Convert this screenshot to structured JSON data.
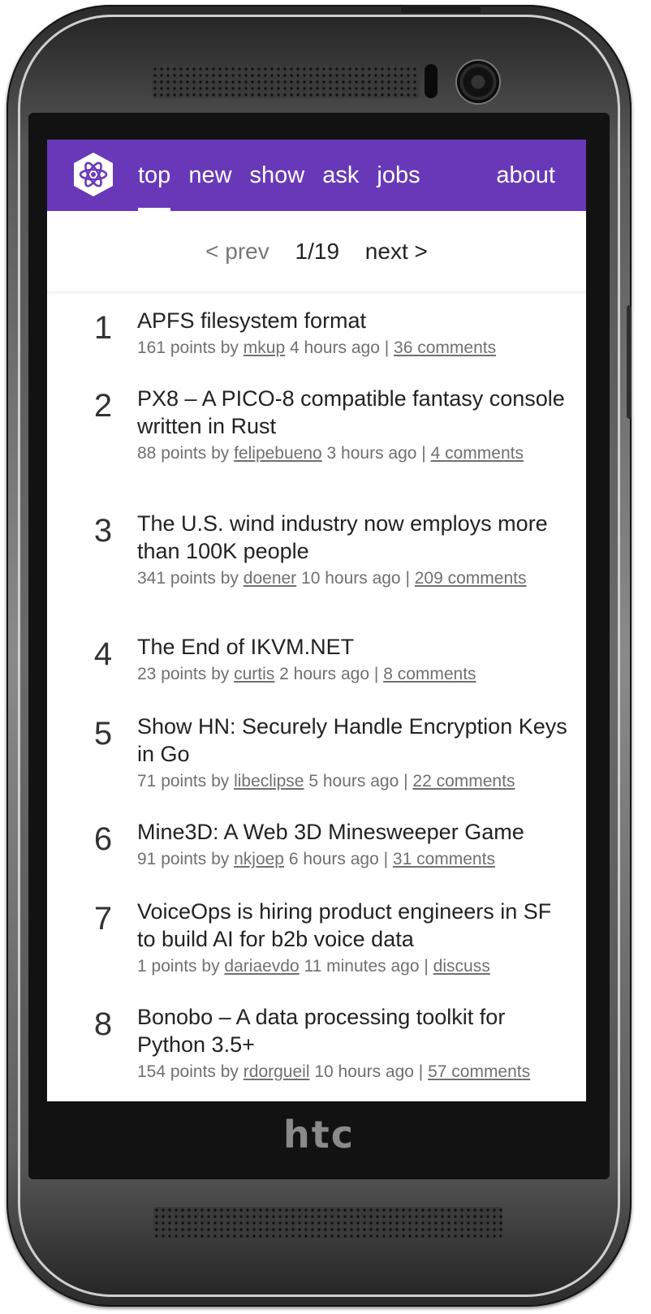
{
  "device": {
    "brand": "htc"
  },
  "header": {
    "nav": [
      {
        "label": "top",
        "active": true
      },
      {
        "label": "new",
        "active": false
      },
      {
        "label": "show",
        "active": false
      },
      {
        "label": "ask",
        "active": false
      },
      {
        "label": "jobs",
        "active": false
      }
    ],
    "about_label": "about",
    "accent_color": "#6938b8"
  },
  "pager": {
    "prev_label": "< prev",
    "current": "1/19",
    "next_label": "next >"
  },
  "items": [
    {
      "rank": "1",
      "title": "APFS filesystem format",
      "points": "161 points by",
      "user": "mkup",
      "time": "4 hours ago |",
      "comments": "36 comments"
    },
    {
      "rank": "2",
      "title": "PX8 – A PICO-8 compatible fantasy console written in Rust",
      "points": "88 points by",
      "user": "felipebueno",
      "time": "3 hours ago |",
      "comments": "4 comments"
    },
    {
      "rank": "3",
      "title": "The U.S. wind industry now employs more than 100K people",
      "points": "341 points by",
      "user": "doener",
      "time": "10 hours ago |",
      "comments": "209 comments"
    },
    {
      "rank": "4",
      "title": "The End of IKVM.NET",
      "points": "23 points by",
      "user": "curtis",
      "time": "2 hours ago |",
      "comments": "8 comments"
    },
    {
      "rank": "5",
      "title": "Show HN: Securely Handle Encryption Keys in Go",
      "points": "71 points by",
      "user": "libeclipse",
      "time": "5 hours ago |",
      "comments": "22 comments"
    },
    {
      "rank": "6",
      "title": "Mine3D: A Web 3D Minesweeper Game",
      "points": "91 points by",
      "user": "nkjoep",
      "time": "6 hours ago |",
      "comments": "31 comments"
    },
    {
      "rank": "7",
      "title": "VoiceOps is hiring product engineers in SF to build AI for b2b voice data",
      "points": "1 points by",
      "user": "dariaevdo",
      "time": "11 minutes ago |",
      "comments": "discuss"
    },
    {
      "rank": "8",
      "title": "Bonobo – A data processing toolkit for Python 3.5+",
      "points": "154 points by",
      "user": "rdorgueil",
      "time": "10 hours ago |",
      "comments": "57 comments"
    }
  ]
}
